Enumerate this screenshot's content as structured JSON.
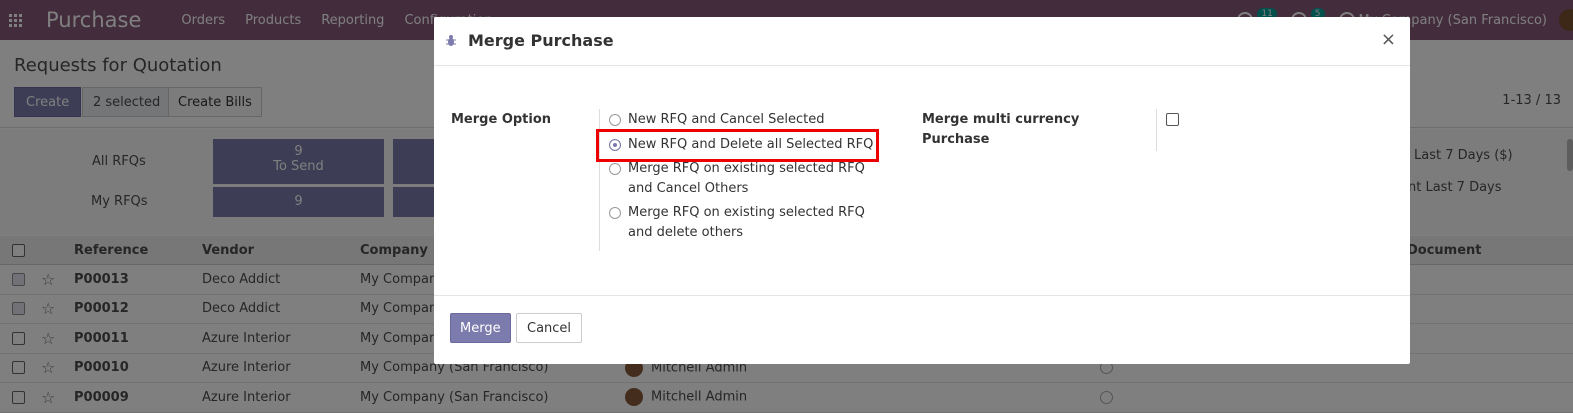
{
  "navbar": {
    "app_name": "Purchase",
    "menu": [
      "Orders",
      "Products",
      "Reporting",
      "Configuration"
    ],
    "activity_badge": "11",
    "messages_badge": "5",
    "company": "My Company (San Francisco)"
  },
  "control_panel": {
    "breadcrumb": "Requests for Quotation",
    "create_label": "Create",
    "selected_label": "2 selected",
    "create_bills_label": "Create Bills",
    "pager": "1-13 / 13"
  },
  "dashboard": {
    "row1_label": "All RFQs",
    "row2_label": "My RFQs",
    "tile1_count": "9",
    "tile1_caption": "To Send",
    "tile2_count": "9",
    "right1": "Last 7 Days ($)",
    "right2": "nt Last 7 Days"
  },
  "list": {
    "headers": [
      "Reference",
      "Vendor",
      "Company",
      "Document"
    ],
    "rows": [
      {
        "ref": "P00013",
        "vendor": "Deco Addict",
        "company": "My Company",
        "user": "",
        "checked": true
      },
      {
        "ref": "P00012",
        "vendor": "Deco Addict",
        "company": "My Company",
        "user": "",
        "checked": true
      },
      {
        "ref": "P00011",
        "vendor": "Azure Interior",
        "company": "My Company",
        "user": "",
        "checked": false
      },
      {
        "ref": "P00010",
        "vendor": "Azure Interior",
        "company": "My Company (San Francisco)",
        "user": "Mitchell Admin",
        "checked": false
      },
      {
        "ref": "P00009",
        "vendor": "Azure Interior",
        "company": "My Company (San Francisco)",
        "user": "Mitchell Admin",
        "checked": false
      }
    ]
  },
  "modal": {
    "title": "Merge Purchase",
    "close_glyph": "×",
    "merge_option_label": "Merge Option",
    "options": [
      {
        "label_line1": "New RFQ and Cancel Selected",
        "label_line2": "",
        "selected": false
      },
      {
        "label_line1": "New RFQ and Delete all Selected RFQ",
        "label_line2": "",
        "selected": true
      },
      {
        "label_line1": "Merge RFQ on existing selected RFQ",
        "label_line2": "and Cancel Others",
        "selected": false
      },
      {
        "label_line1": "Merge RFQ on existing selected RFQ",
        "label_line2": "and delete others",
        "selected": false
      }
    ],
    "multi_currency_label_line1": "Merge multi currency",
    "multi_currency_label_line2": "Purchase",
    "multi_currency_checked": false,
    "merge_button": "Merge",
    "cancel_button": "Cancel"
  },
  "colors": {
    "navbar": "#875a7b",
    "primary": "#7c7bad",
    "highlight": "#e00000"
  }
}
